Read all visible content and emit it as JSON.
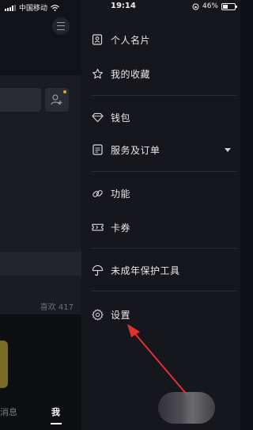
{
  "status_bar": {
    "carrier": "中国移动",
    "time": "19:14",
    "battery_percent": "46%",
    "battery_level": 0.46
  },
  "background": {
    "likes_text": "喜欢 417",
    "tab_messages": "消息",
    "tab_me": "我"
  },
  "drawer": {
    "items": [
      {
        "label": "个人名片",
        "icon": "id-card-icon"
      },
      {
        "label": "我的收藏",
        "icon": "star-icon"
      },
      {
        "label": "钱包",
        "icon": "diamond-wallet-icon"
      },
      {
        "label": "服务及订单",
        "icon": "order-list-icon",
        "expandable": true
      },
      {
        "label": "功能",
        "icon": "link-icon"
      },
      {
        "label": "卡券",
        "icon": "ticket-icon"
      },
      {
        "label": "未成年保护工具",
        "icon": "umbrella-icon"
      },
      {
        "label": "设置",
        "icon": "gear-icon"
      }
    ]
  },
  "colors": {
    "drawer_bg": "#16171c",
    "annotation_arrow": "#e0322e",
    "text": "#e8e8ea"
  }
}
